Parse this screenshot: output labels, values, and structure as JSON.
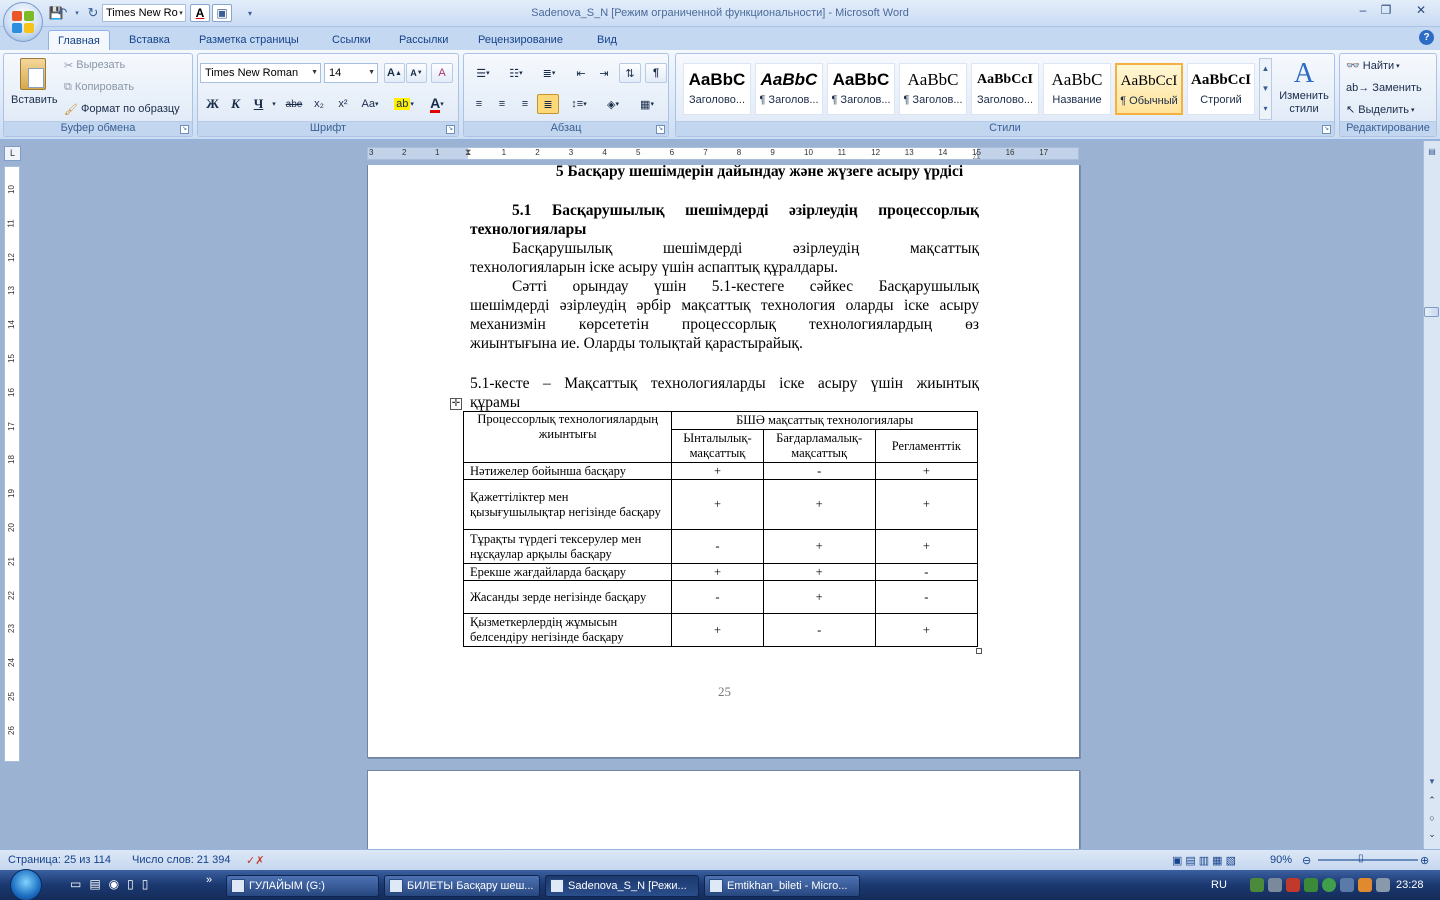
{
  "window": {
    "title": "Sadenova_S_N [Режим ограниченной функциональности] - Microsoft Word",
    "qat_font": "Times New Ro",
    "controls": {
      "minimize": "‒",
      "restore": "❐",
      "close": "✕"
    }
  },
  "ribbon_tabs": [
    "Главная",
    "Вставка",
    "Разметка страницы",
    "Ссылки",
    "Рассылки",
    "Рецензирование",
    "Вид"
  ],
  "clipboard": {
    "label": "Буфер обмена",
    "paste": "Вставить",
    "cut": "Вырезать",
    "copy": "Копировать",
    "format_painter": "Формат по образцу"
  },
  "font": {
    "label": "Шрифт",
    "name": "Times New Roman",
    "size": "14",
    "bold": "Ж",
    "italic": "К",
    "underline": "Ч",
    "strike": "abe",
    "subscript": "x₂",
    "superscript": "x²",
    "change_case": "Aa",
    "grow": "A",
    "shrink": "A",
    "clear": "A"
  },
  "paragraph": {
    "label": "Абзац",
    "pilcrow": "¶"
  },
  "styles": {
    "label": "Стили",
    "items": [
      {
        "preview": "AaBbC",
        "name": "Заголово..."
      },
      {
        "preview": "AaBbC",
        "name": "¶ Заголов..."
      },
      {
        "preview": "AaBbC",
        "name": "¶ Заголов..."
      },
      {
        "preview": "AaBbC",
        "name": "¶ Заголов..."
      },
      {
        "preview": "AaBbCcI",
        "name": "Заголово..."
      },
      {
        "preview": "AaBbC",
        "name": "Название"
      },
      {
        "preview": "AaBbCcI",
        "name": "¶ Обычный"
      },
      {
        "preview": "AaBbCcI",
        "name": "Строгий"
      }
    ],
    "change_styles": "Изменить стили"
  },
  "editing": {
    "label": "Редактирование",
    "find": "Найти",
    "replace": "Заменить",
    "select": "Выделить"
  },
  "rulers": {
    "h_numbers": [
      "3",
      "2",
      "1",
      "1",
      "2",
      "3",
      "4",
      "5",
      "6",
      "7",
      "8",
      "9",
      "10",
      "11",
      "12",
      "13",
      "14",
      "15",
      "16",
      "17"
    ],
    "v_numbers": [
      "10",
      "11",
      "12",
      "13",
      "14",
      "15",
      "16",
      "17",
      "18",
      "19",
      "20",
      "21",
      "22",
      "23",
      "24",
      "25",
      "26"
    ]
  },
  "document": {
    "heading_main": "5 Басқару шешімдерін дайындау және жүзеге асыру үрдісі",
    "heading_sub_line1": "5.1 Басқарушылық шешімдерді әзірлеудің процессорлық",
    "heading_sub_line2": "технологиялары",
    "para1_line1": "Басқарушылық шешімдерді әзірлеудің мақсаттық",
    "para1_line2": "технологияларын іске асыру үшін аспаптық құралдары.",
    "para2_line1": "Сәтті орындау үшін 5.1-кестеге сәйкес Басқарушылық",
    "para2_line2": "шешімдерді әзірлеудің әрбір мақсаттық технология оларды іске асыру",
    "para2_line3": "механизмін көрсететін процессорлық технологиялардың өз",
    "para2_line4": "жиынтығына ие. Оларды толықтай қарастырайық.",
    "caption_line1": "5.1-кесте – Мақсаттық технологияларды іске асыру үшін жиынтық",
    "caption_line2": "құрамы",
    "page_number": "25"
  },
  "table": {
    "header_col1": "Процессорлық технологиялардың жиынтығы",
    "header_group": "БШӘ мақсаттық технологиялары",
    "sub_headers": [
      "Ынталылық-мақсаттық",
      "Бағдарламалық-мақсаттық",
      "Регламенттік"
    ],
    "rows": [
      {
        "name": "Нәтижелер бойынша басқару",
        "v": [
          "+",
          "-",
          "+"
        ]
      },
      {
        "name": "Қажеттіліктер мен қызығушылықтар негізінде басқару",
        "v": [
          "+",
          "+",
          "+"
        ]
      },
      {
        "name": "Тұрақты түрдегі тексерулер мен нұсқаулар арқылы басқару",
        "v": [
          "-",
          "+",
          "+"
        ]
      },
      {
        "name": "Ерекше жағдайларда басқару",
        "v": [
          "+",
          "+",
          "-"
        ]
      },
      {
        "name": "Жасанды зерде негізінде басқару",
        "v": [
          "-",
          "+",
          "-"
        ]
      },
      {
        "name": "Қызметкерлердің жұмысын белсендіру негізінде басқару",
        "v": [
          "+",
          "-",
          "+"
        ]
      }
    ]
  },
  "status": {
    "page": "Страница: 25 из 114",
    "words": "Число слов: 21 394",
    "zoom": "90%"
  },
  "taskbar": {
    "items": [
      "ГУЛАЙЫМ (G:)",
      "БИЛЕТЫ Басқару шеш...",
      "Sadenova_S_N [Режи...",
      "Emtikhan_bileti - Micro..."
    ],
    "lang": "RU",
    "clock": "23:28"
  },
  "colors": {
    "accent": "#15428b",
    "page_bg": "#9bb2d2",
    "selected_style": "#f5b041"
  }
}
